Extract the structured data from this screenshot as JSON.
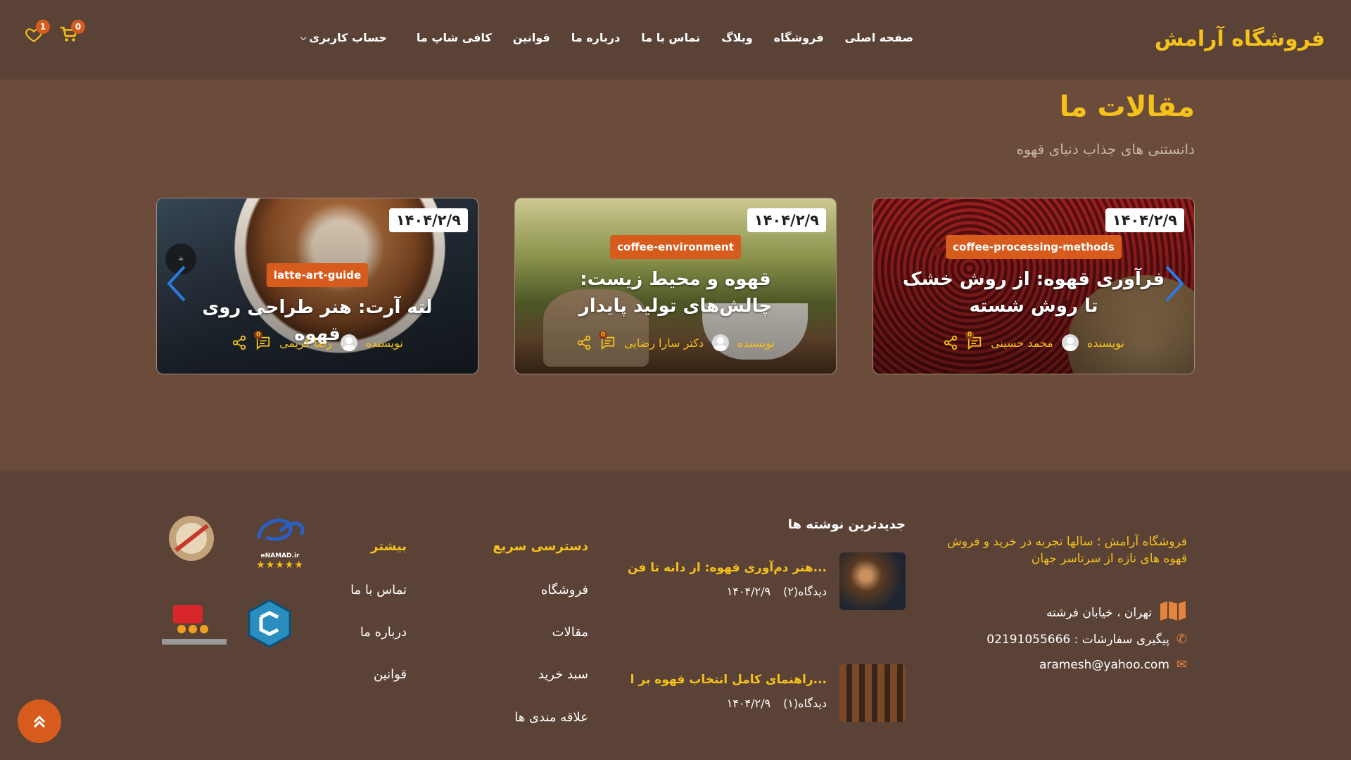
{
  "header": {
    "logo": "فروشگاه آرامش",
    "nav": [
      "صفحه اصلی",
      "فروشگاه",
      "وبلاگ",
      "تماس با ما",
      "درباره ما",
      "قوانین",
      "کافی شاپ ما"
    ],
    "account_label": "حساب کاربری",
    "cart_count": "0",
    "wishlist_count": "1"
  },
  "articles": {
    "title": "مقالات ما",
    "subtitle": "دانستنی های جذاب دنیای قهوه",
    "cards": [
      {
        "date": "۱۴۰۴/۲/۹",
        "tag": "coffee-processing-methods",
        "title": "فرآوری قهوه: از روش خشک تا روش شسته",
        "author_label": "نویسنده",
        "author": "محمد حسینی",
        "comments": "0"
      },
      {
        "date": "۱۴۰۴/۲/۹",
        "tag": "coffee-environment",
        "title": "قهوه و محیط زیست: چالش‌های تولید پایدار",
        "author_label": "نویسنده",
        "author": "دکتر سارا رضایی",
        "comments": "0"
      },
      {
        "date": "۱۴۰۴/۲/۹",
        "tag": "latte-art-guide",
        "title": "لته آرت: هنر طراحی روی قهوه",
        "author_label": "نویسنده",
        "author": "رضا کریمی",
        "comments": "0"
      }
    ]
  },
  "footer": {
    "about": "فروشگاه آرامش ؛ سالها تجربه در خرید و فروش قهوه های تازه از سرتاسر جهان",
    "address": "تهران ، خیابان فرشته",
    "phone": "پیگیری سفارشات : 02191055666",
    "email": "aramesh@yahoo.com",
    "latest_title": "جدیدترین نوشته ها",
    "posts": [
      {
        "title": "هنر دم‌آوری قهوه: از دانه تا فن...",
        "views": "دیدگاه(۲)",
        "date": "۱۴۰۴/۲/۹"
      },
      {
        "title": "راهنمای کامل انتخاب قهوه بر ا...",
        "views": "دیدگاه(۱)",
        "date": "۱۴۰۴/۲/۹"
      }
    ],
    "quick_title": "دسترسی سریع",
    "quick_links": [
      "فروشگاه",
      "مقالات",
      "سبد خرید",
      "علاقه مندی ها"
    ],
    "more_title": "بیشتر",
    "more_links": [
      "تماس با ما",
      "درباره ما",
      "قوانین"
    ],
    "enamad_label": "eNAMAD.ir"
  },
  "colors": {
    "accent": "#f5c21a",
    "orange": "#d75b1c",
    "header_bg": "#5a4237",
    "section_bg": "#6b4c3a"
  }
}
